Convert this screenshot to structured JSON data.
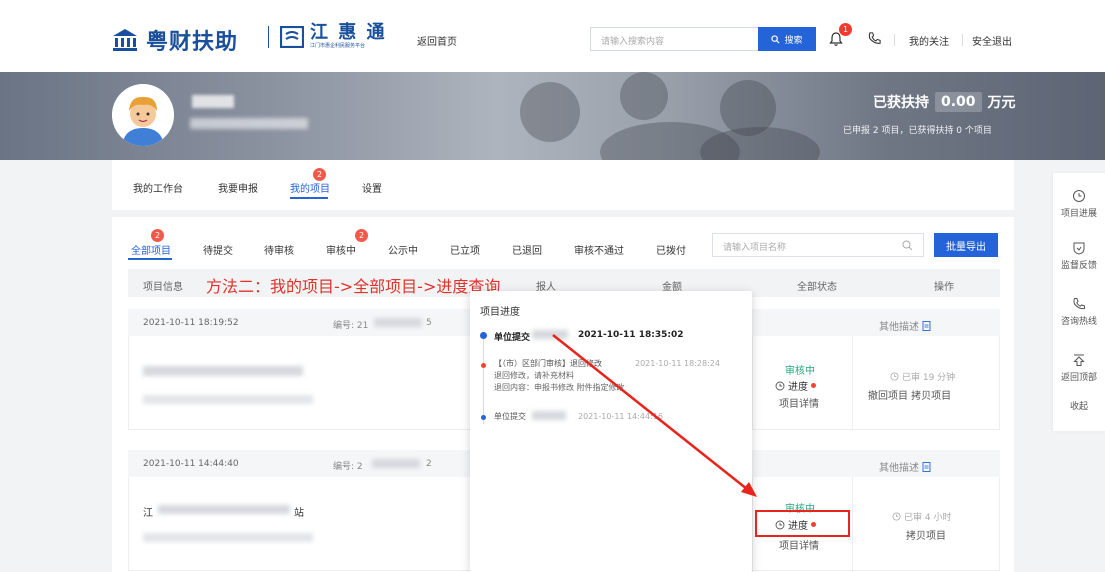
{
  "header": {
    "logo_title": "粤财扶助",
    "sub_logo_title": "江 惠 通",
    "sub_logo_caption": "江门市惠企利民服务平台",
    "home_link": "返回首页",
    "search_placeholder": "请输入搜索内容",
    "search_button": "搜索",
    "notification_count": "1",
    "my_follow": "我的关注",
    "logout": "安全退出"
  },
  "banner": {
    "support_label": "已获扶持",
    "support_amount": "0.00",
    "support_unit": "万元",
    "support_summary": "已申报 2 项目，已获得扶持 0 个项目"
  },
  "nav": {
    "tabs": [
      {
        "label": "我的工作台"
      },
      {
        "label": "我要申报"
      },
      {
        "label": "我的项目",
        "badge": "2"
      },
      {
        "label": "设置"
      }
    ]
  },
  "filters": {
    "tabs": [
      {
        "label": "全部项目",
        "badge": "2"
      },
      {
        "label": "待提交"
      },
      {
        "label": "待审核"
      },
      {
        "label": "审核中",
        "badge": "2"
      },
      {
        "label": "公示中"
      },
      {
        "label": "已立项"
      },
      {
        "label": "已退回"
      },
      {
        "label": "审核不通过"
      },
      {
        "label": "已拨付"
      }
    ],
    "name_placeholder": "请输入项目名称",
    "export_button": "批量导出"
  },
  "table": {
    "headers": {
      "info": "项目信息",
      "applicant": "报人",
      "amount": "金额",
      "status": "全部状态",
      "ops": "操作"
    },
    "rows": [
      {
        "date": "2021-10-11 18:19:52",
        "number_prefix": "编号: 21",
        "number_suffix": "5",
        "status": "审核中",
        "progress": "进度",
        "detail": "项目详情",
        "other_desc": "其他描述",
        "elapsed": "已审 19 分钟",
        "ops": "撤回项目  拷贝项目"
      },
      {
        "date": "2021-10-11 14:44:40",
        "number_prefix": "编号: 2",
        "number_suffix": "2",
        "name_prefix": "江",
        "name_suffix": "站",
        "status": "审核中",
        "progress": "进度",
        "detail": "项目详情",
        "other_desc": "其他描述",
        "elapsed": "已审 4 小时",
        "ops": "拷贝项目"
      }
    ]
  },
  "annotation": {
    "method_text": "方法二：我的项目->全部项目->进度查询"
  },
  "popover": {
    "title": "项目进度",
    "entries": [
      {
        "label": "单位提交",
        "time": "2021-10-11 18:35:02"
      },
      {
        "label": "【（市）区部门审核】退回修改",
        "time": "2021-10-11 18:28:24",
        "line1": "退回修改，请补充材料",
        "line2": "退回内容：申报书修改 附件指定修改"
      },
      {
        "label": "单位提交",
        "time": "2021-10-11 14:44:16"
      }
    ]
  },
  "floatbar": {
    "items": [
      {
        "label": "项目进展"
      },
      {
        "label": "监督反馈"
      },
      {
        "label": "咨询热线"
      },
      {
        "label": "返回顶部"
      },
      {
        "label": "收起"
      }
    ]
  }
}
